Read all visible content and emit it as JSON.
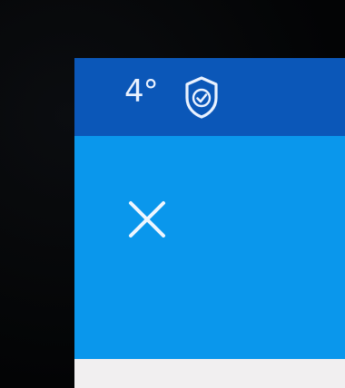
{
  "status_bar": {
    "temperature": "4°",
    "security_icon": "shield-check-icon",
    "background": "#0b57b8"
  },
  "toolbar": {
    "close_icon": "close-icon",
    "background": "#0a97ec"
  },
  "content": {
    "background": "#f1eff0"
  }
}
